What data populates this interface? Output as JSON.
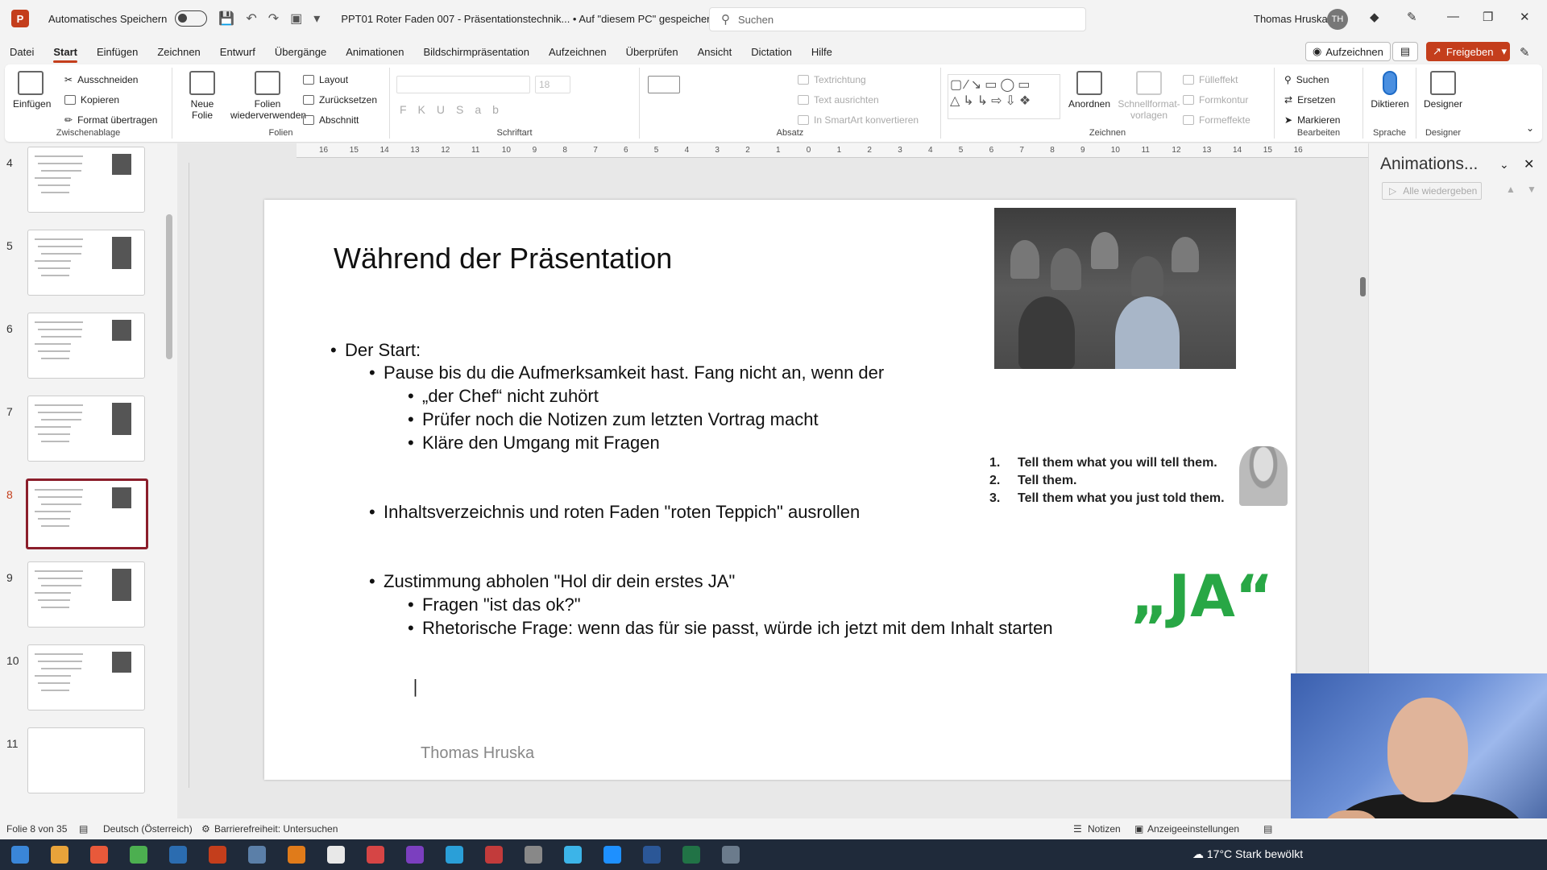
{
  "titlebar": {
    "app_icon": "P",
    "autosave_label": "Automatisches Speichern",
    "doc_title": "PPT01 Roter Faden 007 - Präsentationstechnik...  •  Auf \"diesem PC\" gespeichert",
    "search_placeholder": "Suchen",
    "user_name": "Thomas Hruska",
    "user_initials": "TH"
  },
  "menu": {
    "tabs": [
      "Datei",
      "Start",
      "Einfügen",
      "Zeichnen",
      "Entwurf",
      "Übergänge",
      "Animationen",
      "Bildschirmpräsentation",
      "Aufzeichnen",
      "Überprüfen",
      "Ansicht",
      "Dictation",
      "Hilfe"
    ],
    "active": "Start",
    "record_btn": "Aufzeichnen",
    "share_btn": "Freigeben"
  },
  "ribbon": {
    "clipboard": {
      "paste": "Einfügen",
      "cut": "Ausschneiden",
      "copy": "Kopieren",
      "format": "Format übertragen",
      "label": "Zwischenablage"
    },
    "slides": {
      "new": "Neue Folie",
      "reuse": "Folien wiederverwenden",
      "layout": "Layout",
      "reset": "Zurücksetzen",
      "section": "Abschnitt",
      "label": "Folien"
    },
    "font": {
      "size": "18",
      "label": "Schriftart"
    },
    "paragraph": {
      "direction": "Textrichtung",
      "align": "Text ausrichten",
      "smartart": "In SmartArt konvertieren",
      "label": "Absatz"
    },
    "drawing": {
      "arrange": "Anordnen",
      "quickstyles": "Schnellformat-vorlagen",
      "fill": "Fülleffekt",
      "outline": "Formkontur",
      "effects": "Formeffekte",
      "label": "Zeichnen"
    },
    "editing": {
      "find": "Suchen",
      "replace": "Ersetzen",
      "select": "Markieren",
      "label": "Bearbeiten"
    },
    "voice": {
      "dictate": "Diktieren",
      "label": "Sprache"
    },
    "designer": {
      "btn": "Designer",
      "label": "Designer"
    }
  },
  "thumbnails": {
    "numbers": [
      "4",
      "5",
      "6",
      "7",
      "8",
      "9",
      "10",
      "11"
    ],
    "selected": "8"
  },
  "slide": {
    "title": "Während der Präsentation",
    "bullets": [
      "Der Start:",
      "Pause bis du die Aufmerksamkeit hast. Fang nicht an, wenn der",
      "„der Chef“ nicht zuhört",
      "Prüfer noch die Notizen zum letzten Vortrag macht",
      "Kläre den Umgang mit Fragen",
      "Inhaltsverzeichnis und roten Faden \"roten Teppich\" ausrollen",
      "Zustimmung abholen \"Hol dir dein erstes JA\"",
      "Fragen \"ist das ok?\"",
      "Rhetorische Frage: wenn das für sie passt, würde ich jetzt mit dem Inhalt starten"
    ],
    "tell_list": [
      {
        "n": "1.",
        "text": "Tell them what you will tell them."
      },
      {
        "n": "2.",
        "text": "Tell them."
      },
      {
        "n": "3.",
        "text": "Tell them what you just told them."
      }
    ],
    "ja_text": "„JA“",
    "author": "Thomas Hruska"
  },
  "animation_pane": {
    "title": "Animations...",
    "play_all": "Alle wiedergeben"
  },
  "statusbar": {
    "slide_info": "Folie 8 von 35",
    "language": "Deutsch (Österreich)",
    "accessibility": "Barrierefreiheit: Untersuchen",
    "notes": "Notizen",
    "display": "Anzeigeeinstellungen"
  },
  "taskbar": {
    "weather": "17°C  Stark bewölkt"
  },
  "colors": {
    "accent": "#c43e1c",
    "selected_thumb": "#8b1e2b",
    "ja_green": "#28a745"
  }
}
